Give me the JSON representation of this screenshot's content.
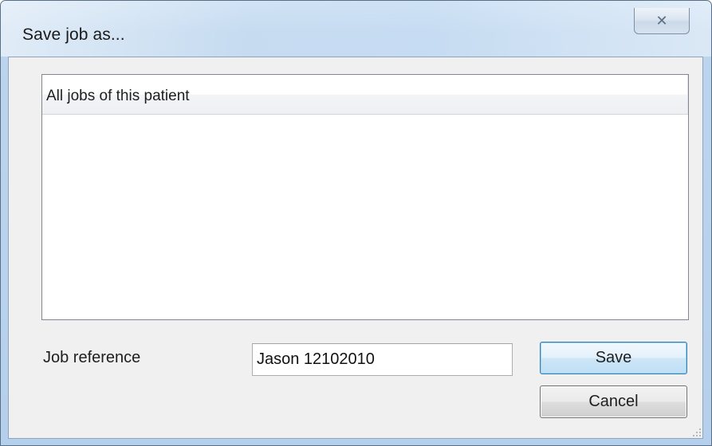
{
  "window": {
    "title": "Save job as...",
    "close_glyph": "✕"
  },
  "list": {
    "column_header": "All jobs of this patient",
    "items": []
  },
  "form": {
    "job_reference_label": "Job reference",
    "job_reference_value": "Jason 12102010"
  },
  "buttons": {
    "save_label": "Save",
    "cancel_label": "Cancel"
  },
  "icons": {
    "close": "close-icon",
    "resize": "resize-grip-icon"
  }
}
